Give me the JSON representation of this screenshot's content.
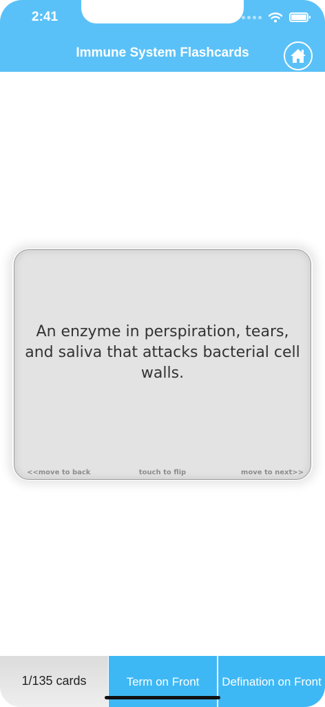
{
  "status_bar": {
    "time": "2:41"
  },
  "header": {
    "title": "Immune System Flashcards"
  },
  "card": {
    "text": "An enzyme in perspiration, tears, and saliva that attacks bacterial cell walls.",
    "hint_back": "<<move to back",
    "hint_flip": "touch to flip",
    "hint_next": "move to next>>"
  },
  "bottom_bar": {
    "count": "1/135 cards",
    "term_front_label": "Term on Front",
    "definition_front_label": "Defination on Front"
  },
  "colors": {
    "header_blue": "#5ac1f8",
    "button_blue": "#3eb8f5",
    "card_gray": "#e3e3e3"
  }
}
